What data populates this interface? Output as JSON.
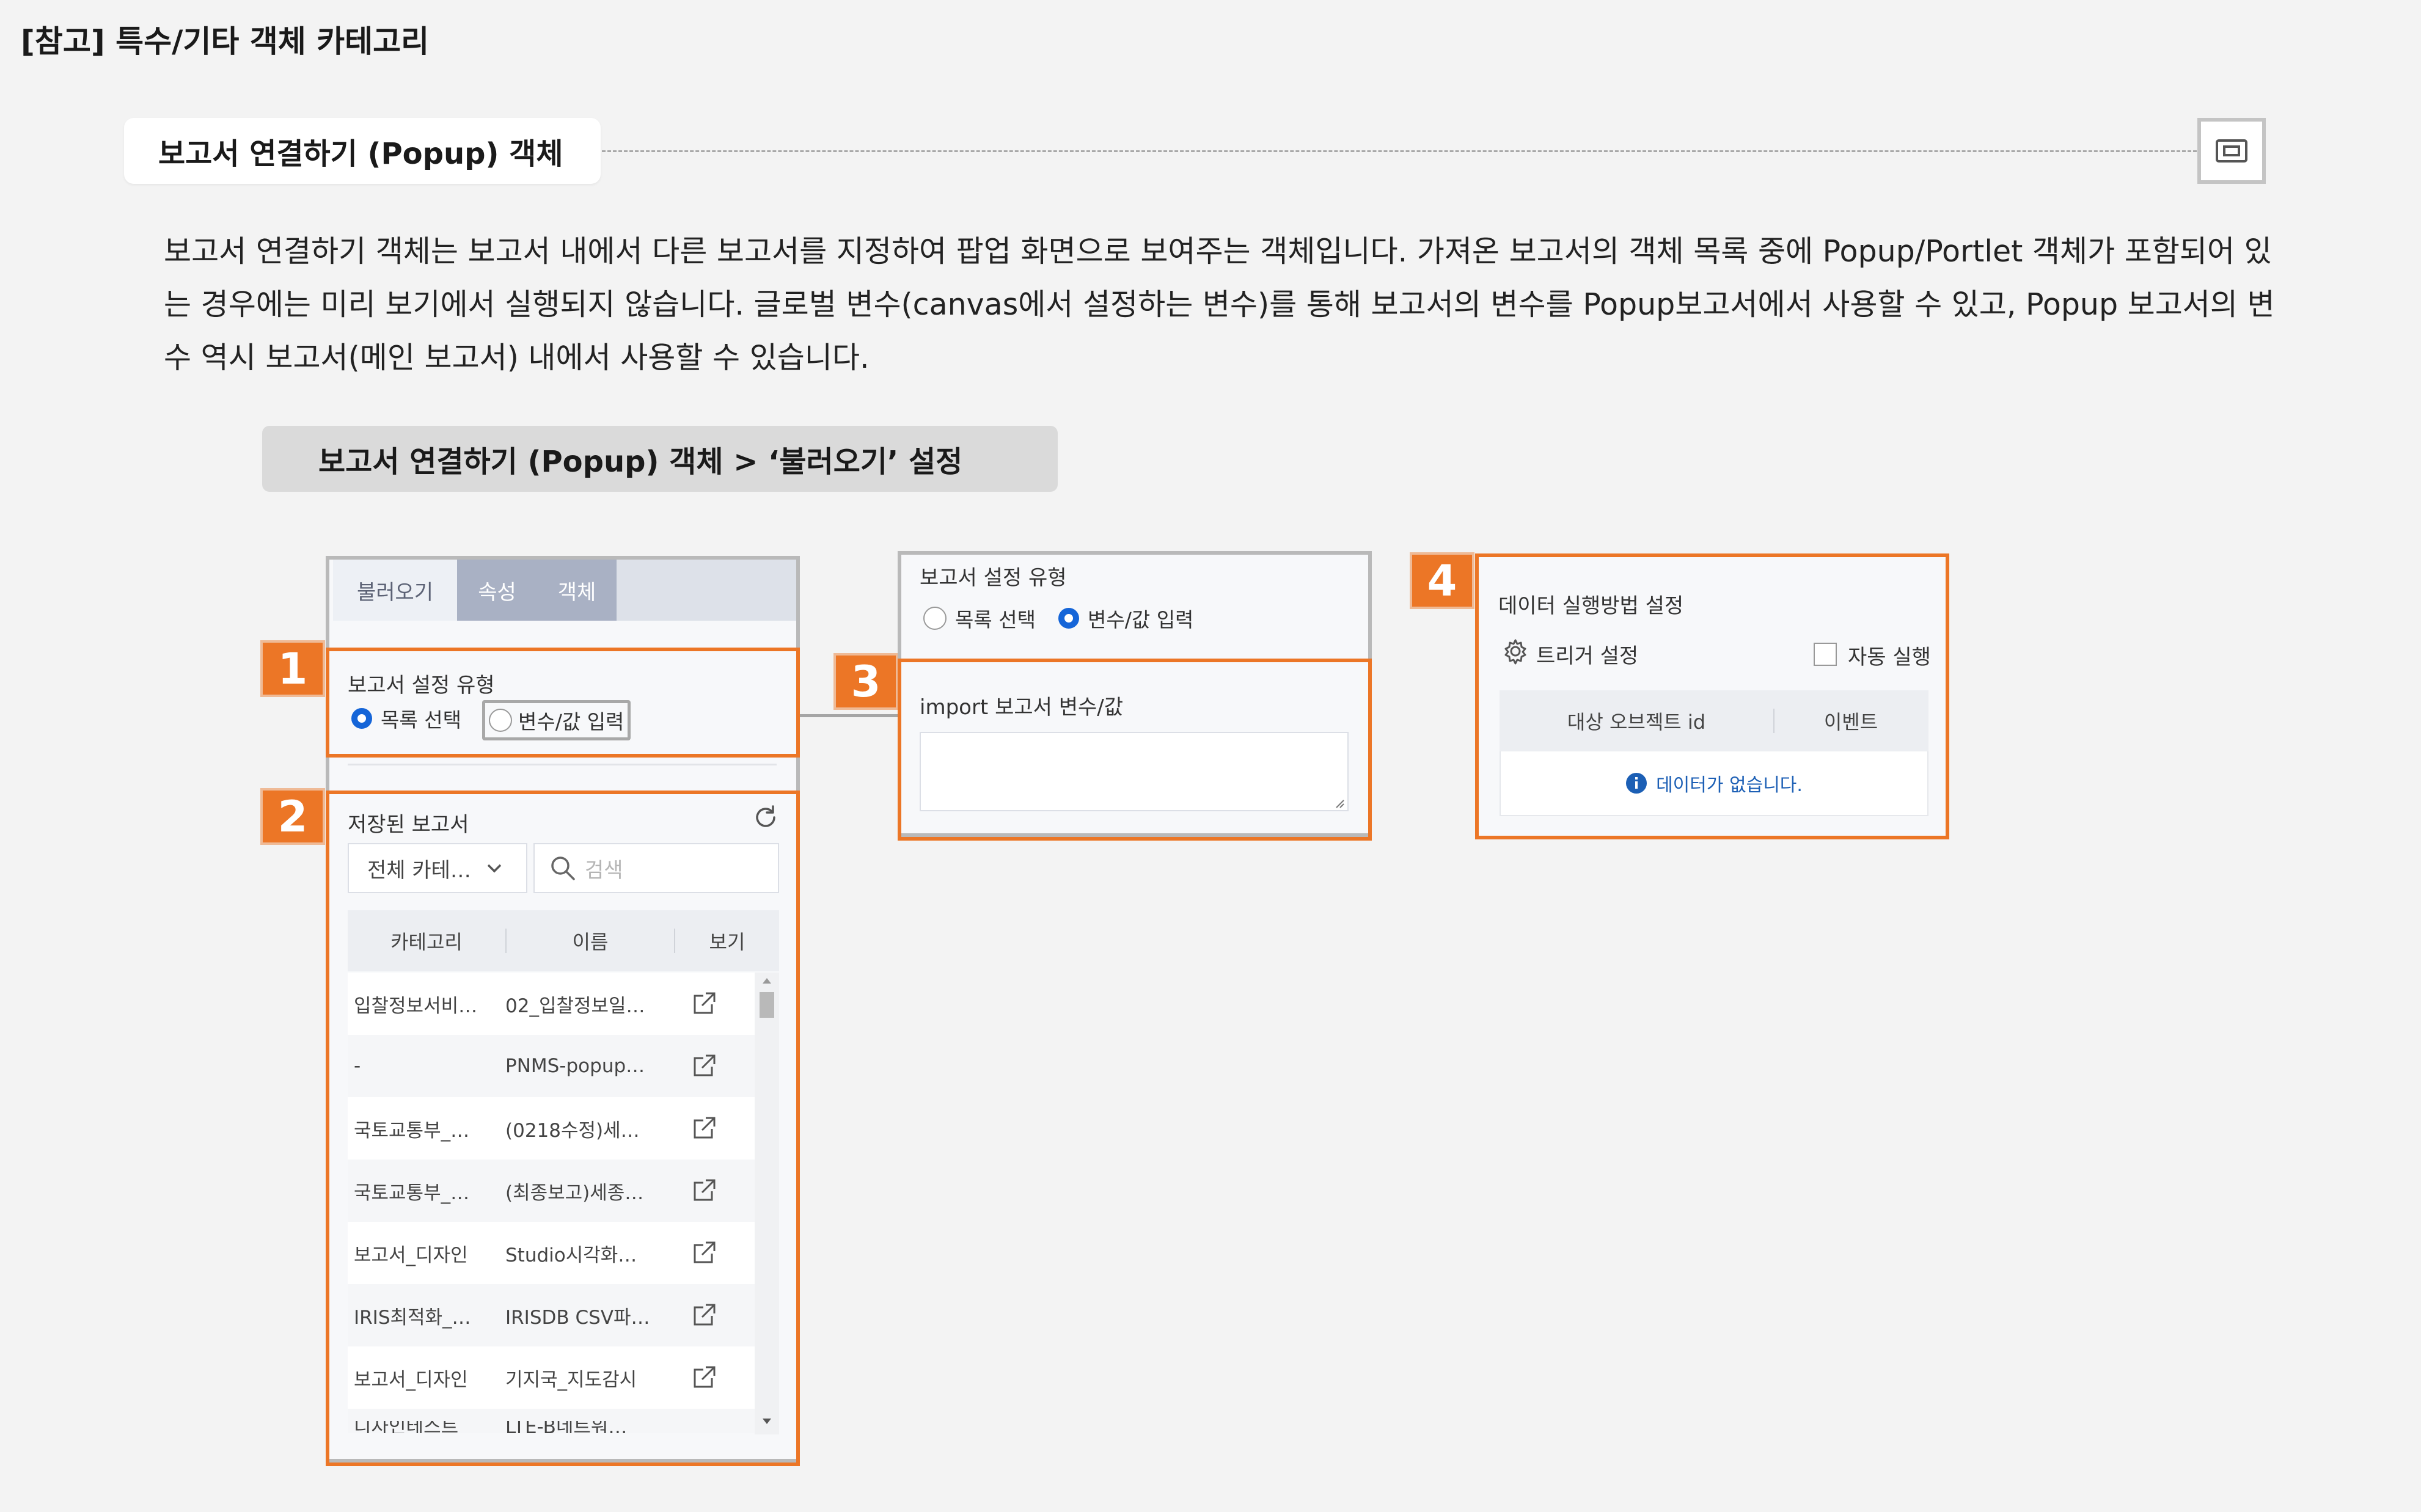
{
  "page": {
    "title": "[참고] 특수/기타 객체 카테고리",
    "section_title": "보고서 연결하기 (Popup) 객체",
    "description": "보고서 연결하기 객체는 보고서 내에서 다른 보고서를 지정하여 팝업 화면으로 보여주는 객체입니다. 가져온 보고서의 객체 목록 중에 Popup/Portlet 객체가 포함되어 있는 경우에는 미리 보기에서 실행되지 않습니다. 글로벌 변수(canvas에서 설정하는 변수)를 통해 보고서의 변수를 Popup보고서에서 사용할 수 있고, Popup 보고서의 변수 역시 보고서(메인 보고서) 내에서 사용할 수 있습니다.",
    "subsection_title": "보고서 연결하기 (Popup) 객체 > ‘불러오기’ 설정"
  },
  "badges": [
    "1",
    "2",
    "3",
    "4"
  ],
  "panel": {
    "tabs": [
      {
        "label": "불러오기",
        "active": true
      },
      {
        "label": "속성",
        "active": false
      },
      {
        "label": "객체",
        "active": false
      }
    ],
    "report_type": {
      "label": "보고서 설정 유형",
      "options": [
        "목록 선택",
        "변수/값 입력"
      ],
      "selected": "목록 선택"
    },
    "saved_reports": {
      "label": "저장된 보고서",
      "category_select": "전체 카테…",
      "search_placeholder": "검색",
      "columns": [
        "카테고리",
        "이름",
        "보기"
      ],
      "rows": [
        {
          "category": "입찰정보서비…",
          "name": "02_입찰정보일…"
        },
        {
          "category": "-",
          "name": "PNMS-popup…"
        },
        {
          "category": "국토교통부_…",
          "name": "(0218수정)세…"
        },
        {
          "category": "국토교통부_…",
          "name": "(최종보고)세종…"
        },
        {
          "category": "보고서_디자인",
          "name": "Studio시각화…"
        },
        {
          "category": "IRIS최적화_…",
          "name": "IRISDB CSV파…"
        },
        {
          "category": "보고서_디자인",
          "name": "기지국_지도감시"
        },
        {
          "category": "디자인테스트",
          "name": "LTE-B네트워…"
        }
      ]
    }
  },
  "panel3": {
    "type_label": "보고서 설정 유형",
    "options": [
      "목록 선택",
      "변수/값 입력"
    ],
    "selected": "변수/값 입력",
    "import_label": "import 보고서 변수/값",
    "textarea_value": ""
  },
  "panel4": {
    "title": "데이터 실행방법 설정",
    "trigger_label": "트리거 설정",
    "auto_run_label": "자동 실행",
    "auto_run_checked": false,
    "columns": [
      "대상 오브젝트 id",
      "이벤트"
    ],
    "empty_message": "데이터가 없습니다."
  },
  "colors": {
    "accent_orange": "#ec7626",
    "radio_blue": "#1565d8",
    "tab_inactive": "#a9b1c4",
    "info_blue": "#1c5fb5"
  }
}
